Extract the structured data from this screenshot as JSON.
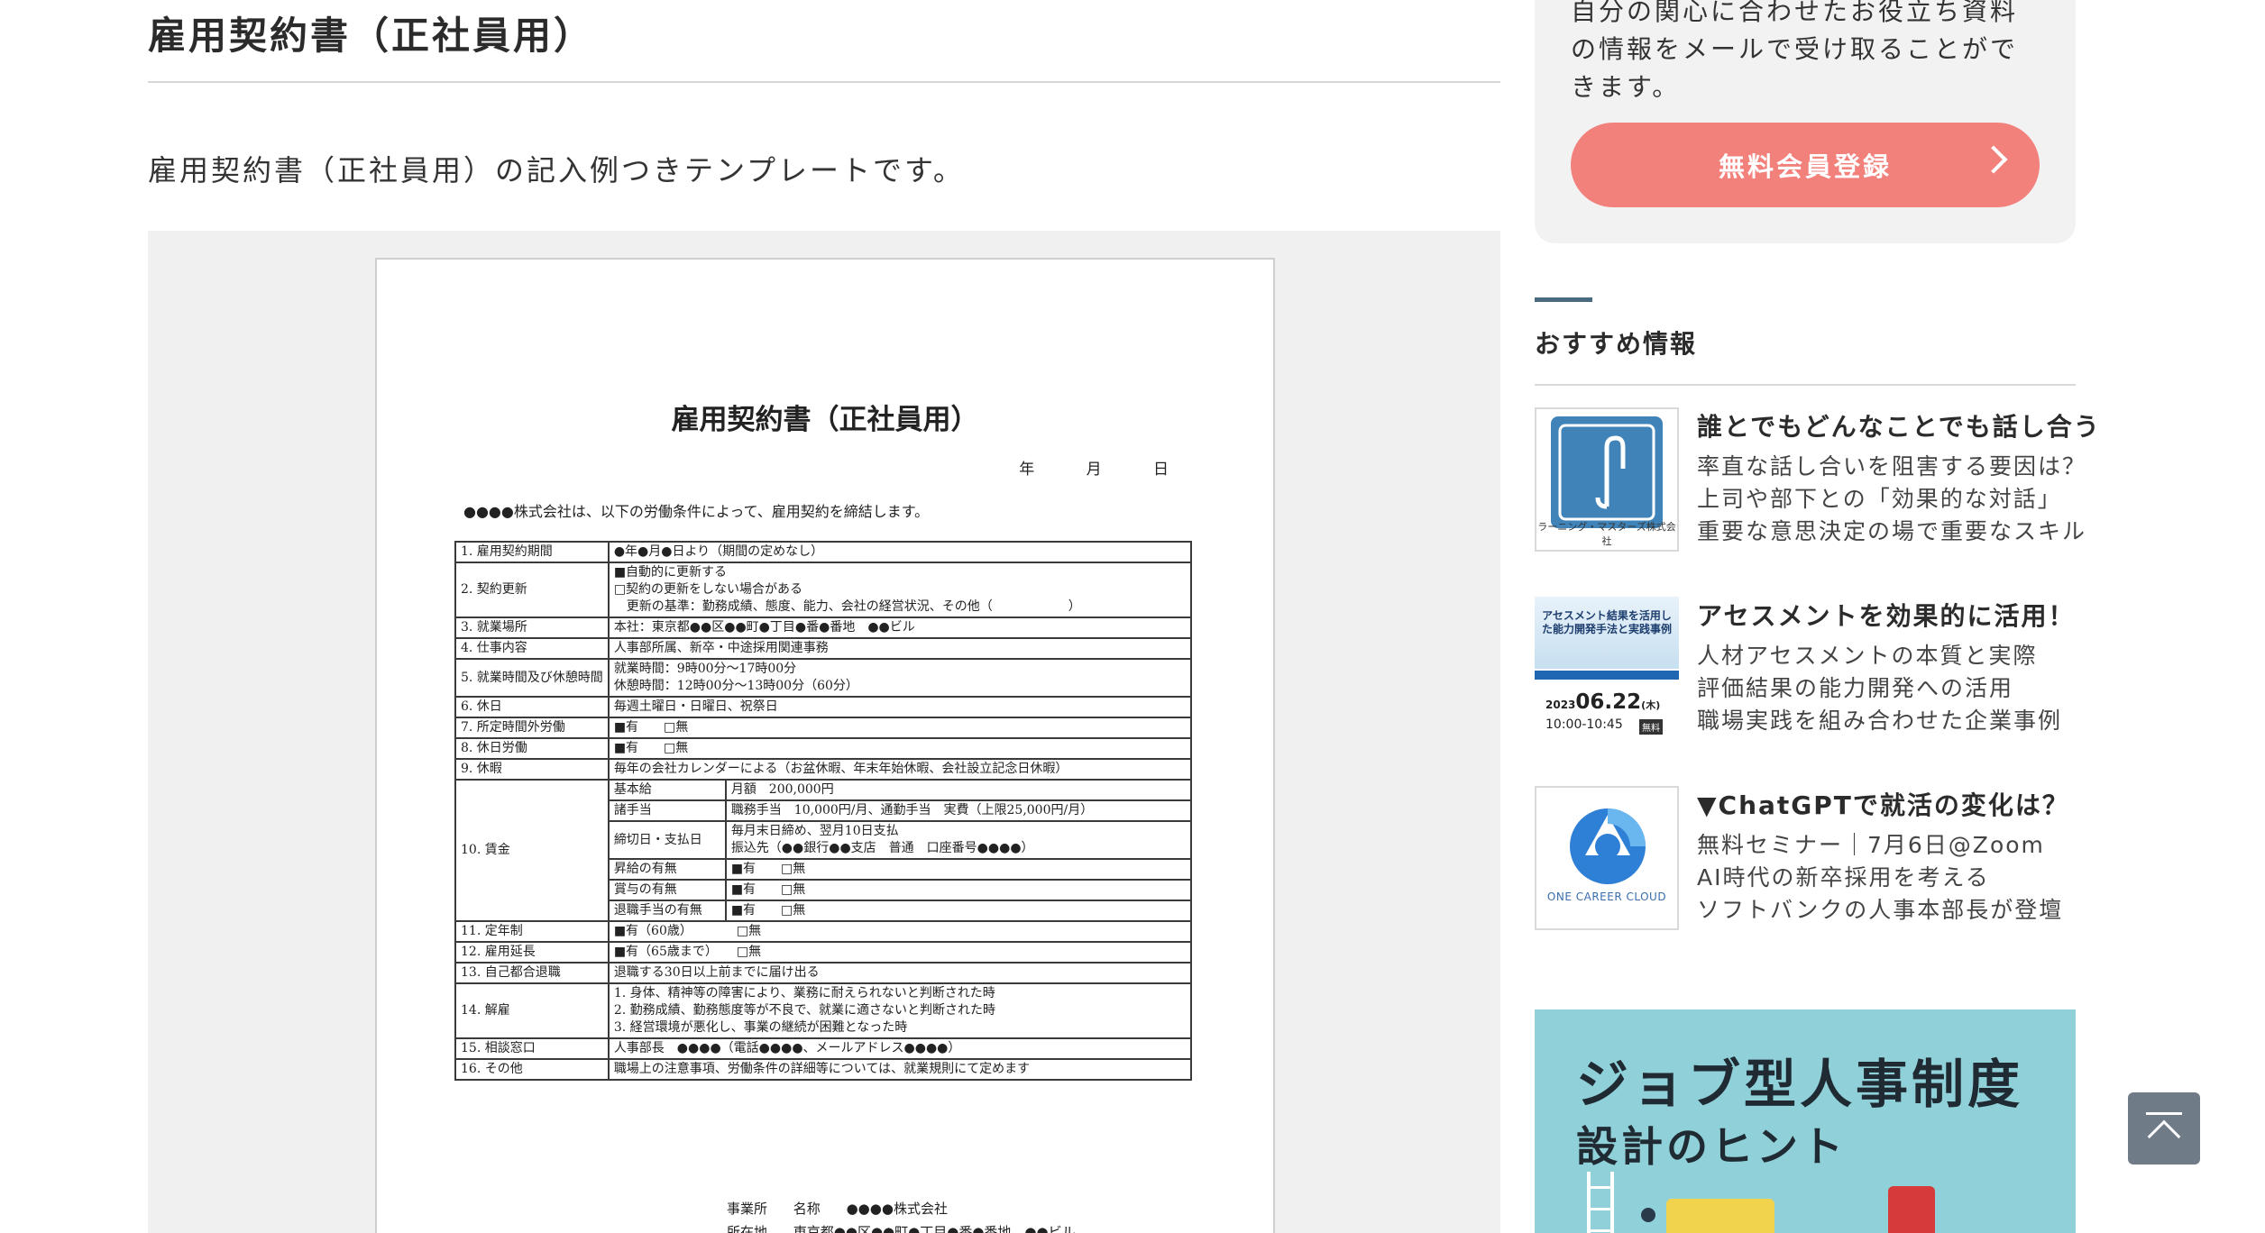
{
  "main": {
    "title": "雇用契約書（正社員用）",
    "lead": "雇用契約書（正社員用）の記入例つきテンプレートです。"
  },
  "document": {
    "title": "雇用契約書（正社員用）",
    "date": "年 月 日",
    "intro": "●●●●株式会社は、以下の労働条件によって、雇用契約を締結します。",
    "rows": [
      {
        "label": "1. 雇用契約期間",
        "lines": [
          "●年●月●日より（期間の定めなし）"
        ]
      },
      {
        "label": "2. 契約更新",
        "lines": [
          "■自動的に更新する",
          "□契約の更新をしない場合がある",
          "　更新の基準：勤務成績、態度、能力、会社の経営状況、その他（　　　　　　）"
        ]
      },
      {
        "label": "3. 就業場所",
        "lines": [
          "本社：東京都●●区●●町●丁目●番●番地　●●ビル"
        ]
      },
      {
        "label": "4. 仕事内容",
        "lines": [
          "人事部所属、新卒・中途採用関連事務"
        ]
      },
      {
        "label": "5. 就業時間及び休憩時間",
        "lines": [
          "就業時間：9時00分〜17時00分",
          "休憩時間：12時00分〜13時00分（60分）"
        ]
      },
      {
        "label": "6. 休日",
        "lines": [
          "毎週土曜日・日曜日、祝祭日"
        ]
      },
      {
        "label": "7. 所定時間外労働",
        "lines": [
          "■有　　□無"
        ]
      },
      {
        "label": "8. 休日労働",
        "lines": [
          "■有　　□無"
        ]
      },
      {
        "label": "9. 休暇",
        "lines": [
          "毎年の会社カレンダーによる（お盆休暇、年末年始休暇、会社設立記念日休暇）"
        ]
      }
    ],
    "wage": {
      "label": "10. 賃金",
      "rows": [
        {
          "label": "基本給",
          "lines": [
            "月額　200,000円"
          ]
        },
        {
          "label": "諸手当",
          "lines": [
            "職務手当　10,000円/月、通勤手当　実費（上限25,000円/月）"
          ]
        },
        {
          "label": "締切日・支払日",
          "lines": [
            "毎月末日締め、翌月10日支払",
            "振込先（●●銀行●●支店　普通　口座番号●●●●）"
          ]
        },
        {
          "label": "昇給の有無",
          "lines": [
            "■有　　□無"
          ]
        },
        {
          "label": "賞与の有無",
          "lines": [
            "■有　　□無"
          ]
        },
        {
          "label": "退職手当の有無",
          "lines": [
            "■有　　□無"
          ]
        }
      ]
    },
    "rows2": [
      {
        "label": "11. 定年制",
        "lines": [
          "■有（60歳）　　　　□無"
        ]
      },
      {
        "label": "12. 雇用延長",
        "lines": [
          "■有（65歳まで）　　□無"
        ]
      },
      {
        "label": "13. 自己都合退職",
        "lines": [
          "退職する30日以上前までに届け出る"
        ]
      },
      {
        "label": "14. 解雇",
        "lines": [
          "1. 身体、精神等の障害により、業務に耐えられないと判断された時",
          "2. 勤務成績、勤務態度等が不良で、就業に適さないと判断された時",
          "3. 経営環境が悪化し、事業の継続が困難となった時"
        ]
      },
      {
        "label": "15. 相談窓口",
        "lines": [
          "人事部長　●●●●（電話●●●●、メールアドレス●●●●）"
        ]
      },
      {
        "label": "16. その他",
        "lines": [
          "職場上の注意事項、労働条件の詳細等については、就業規則にて定めます"
        ]
      }
    ],
    "footer": {
      "row1_a": "事業所",
      "row1_b": "名称",
      "row1_c": "●●●●株式会社",
      "row2_a": "所在地",
      "row2_c": "東京都●●区●●町●丁目●番●番地　●●ビル"
    }
  },
  "sidebar": {
    "member_text": "自分の関心に合わせたお役立ち資料の情報をメールで受け取ることができます。",
    "member_button": "無料会員登録",
    "rec_heading": "おすすめ情報",
    "items": [
      {
        "title": "誰とでもどんなことでも話し合う",
        "lines": [
          "率直な話し合いを阻害する要因は？",
          "上司や部下との「効果的な対話」",
          "重要な意思決定の場で重要なスキル"
        ],
        "thumb_caption": "ラーニング・マスターズ株式会社"
      },
      {
        "title": "アセスメントを効果的に活用！",
        "lines": [
          "人材アセスメントの本質と実際",
          "評価結果の能力開発への活用",
          "職場実践を組み合わせた企業事例"
        ],
        "thumb_text": "アセスメント結果を活用した能力開発手法と実践事例",
        "thumb_date": "06.22",
        "thumb_year": "2023",
        "thumb_weekday": "(木)",
        "thumb_time": "10:00-10:45",
        "thumb_badge": "無料"
      },
      {
        "title": "▼ChatGPTで就活の変化は？",
        "lines": [
          "無料セミナー｜7月6日@Zoom",
          "AI時代の新卒採用を考える",
          "ソフトバンクの人事本部長が登壇"
        ],
        "thumb_caption": "ONE CAREER CLOUD"
      }
    ],
    "banner_line1": "ジョブ型人事制度",
    "banner_line2": "設計のヒント"
  },
  "colors": {
    "accent_button": "#f2817c",
    "heading_bar": "#4a6a82",
    "banner_bg": "#8fd0d9",
    "to_top_bg": "#6f7b87"
  },
  "icons": {
    "member_button": "chevron-right-icon",
    "to_top": "arrow-up-to-top-icon"
  }
}
